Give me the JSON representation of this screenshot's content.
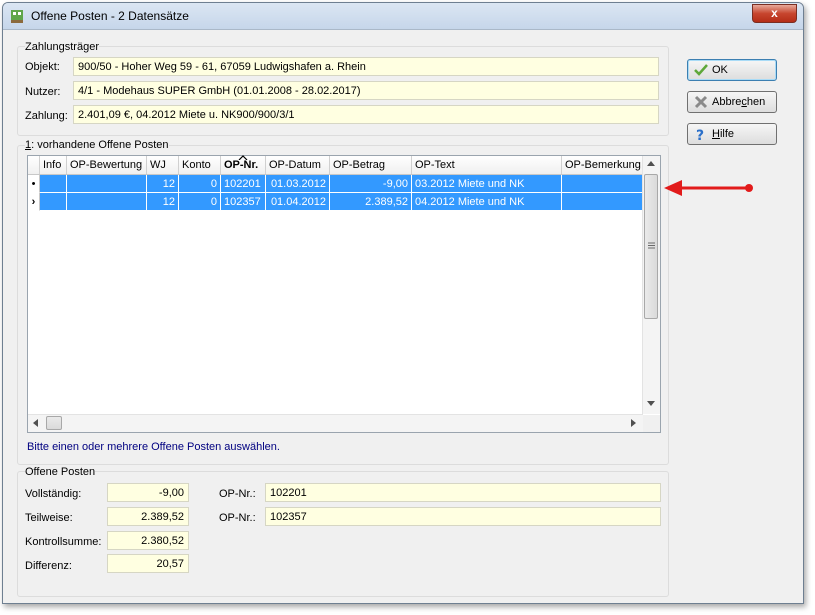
{
  "window": {
    "title": "Offene Posten - 2 Datensätze",
    "close": "x"
  },
  "zahlungstraeger": {
    "title": "Zahlungsträger",
    "objekt": {
      "label": "Objekt:",
      "value": "900/50 - Hoher Weg 59 - 61, 67059 Ludwigshafen a. Rhein"
    },
    "nutzer": {
      "label": "Nutzer:",
      "value": "4/1 - Modehaus SUPER GmbH  (01.01.2008 - 28.02.2017)"
    },
    "zahlung": {
      "label": "Zahlung:",
      "value": "2.401,09 €,  04.2012 Miete u. NK900/900/3/1"
    }
  },
  "list": {
    "title_prefix": "1",
    "title_rest": ": vorhandene Offene Posten",
    "columns": [
      "Info",
      "OP-Bewertung",
      "WJ",
      "Konto",
      "OP-Nr.",
      "OP-Datum",
      "OP-Betrag",
      "OP-Text",
      "OP-Bemerkung"
    ],
    "rows": [
      {
        "indicator": "•",
        "info": "",
        "bewertung": "",
        "wj": "12",
        "konto": "0",
        "nr": "102201",
        "datum": "01.03.2012",
        "betrag": "-9,00",
        "text": "03.2012 Miete und NK",
        "bemerkung": ""
      },
      {
        "indicator": "›",
        "info": "",
        "bewertung": "",
        "wj": "12",
        "konto": "0",
        "nr": "102357",
        "datum": "01.04.2012",
        "betrag": "2.389,52",
        "text": "04.2012 Miete und NK",
        "bemerkung": ""
      }
    ],
    "hint": "Bitte einen oder mehrere Offene Posten auswählen."
  },
  "offene_posten": {
    "title": "Offene Posten",
    "vollstaendig": {
      "label": "Vollständig:",
      "value": "-9,00"
    },
    "teilweise": {
      "label": "Teilweise:",
      "value": "2.389,52"
    },
    "kontrollsumme": {
      "label": "Kontrollsumme:",
      "value": "2.380,52"
    },
    "differenz": {
      "label": "Differenz:",
      "value": "20,57"
    },
    "op_nr_1": {
      "label": "OP-Nr.:",
      "value": "102201"
    },
    "op_nr_2": {
      "label": "OP-Nr.:",
      "value": "102357"
    }
  },
  "buttons": {
    "ok": "OK",
    "abbrechen_pre": "Abbre",
    "abbrechen_u": "c",
    "abbrechen_post": "hen",
    "hilfe_u": "H",
    "hilfe_post": "ilfe"
  },
  "colors": {
    "selection": "#3399ff",
    "field_bg": "#ffffe1",
    "arrow": "#e21b1b",
    "hint": "#000080"
  }
}
